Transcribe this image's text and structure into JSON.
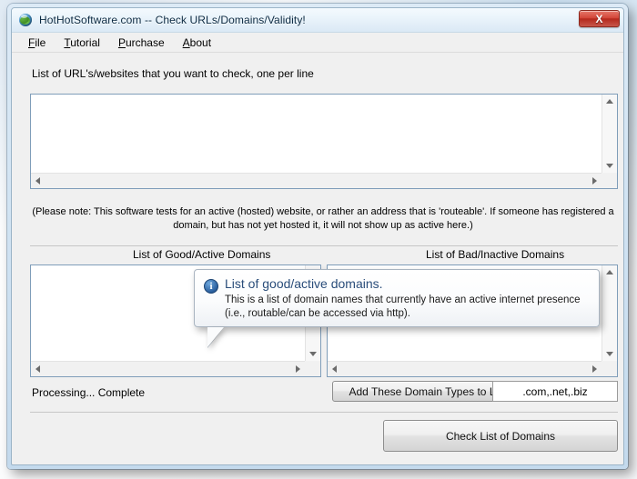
{
  "window": {
    "title": "HotHotSoftware.com -- Check URLs/Domains/Validity!",
    "app_icon": "globe-icon",
    "close_label": "X"
  },
  "menubar": {
    "items": [
      {
        "prefix": "",
        "key": "F",
        "suffix": "ile",
        "name": "file"
      },
      {
        "prefix": "",
        "key": "T",
        "suffix": "utorial",
        "name": "tutorial"
      },
      {
        "prefix": "",
        "key": "P",
        "suffix": "urchase",
        "name": "purchase"
      },
      {
        "prefix": "",
        "key": "A",
        "suffix": "bout",
        "name": "about"
      }
    ],
    "labels": [
      "File",
      "Tutorial",
      "Purchase",
      "About"
    ]
  },
  "main": {
    "url_list_label": "List of URL's/websites that you want to check, one per line",
    "url_list_value": "",
    "note_line1": "(Please note: This software tests for an active (hosted) website, or rather an address that is 'routeable'. If someone has registered a",
    "note_line2": "domain, but has not yet hosted it, it will not show up as active here.)",
    "good_list_label": "List of Good/Active Domains",
    "good_list_value": "",
    "bad_list_label": "List of Bad/Inactive Domains",
    "bad_list_value": "",
    "status_text": "Processing... Complete",
    "add_domains_button": "Add These Domain Types to List",
    "domain_types_value": ".com,.net,.biz",
    "domain_types_placeholder": ".com,.net,.biz",
    "check_button": "Check List of Domains"
  },
  "tooltip": {
    "icon": "info-icon",
    "icon_glyph": "i",
    "title": "List of good/active domains.",
    "body_line1": "This is a list of domain names that currently have an active internet presence",
    "body_line2": "(i.e., routable/can be accessed via http)."
  },
  "colors": {
    "title_text": "#0c2a42",
    "tooltip_title": "#2a4d7a",
    "close_button": "#c6392b",
    "textbox_border": "#7f9db9",
    "client_background": "#f0f0f0"
  }
}
